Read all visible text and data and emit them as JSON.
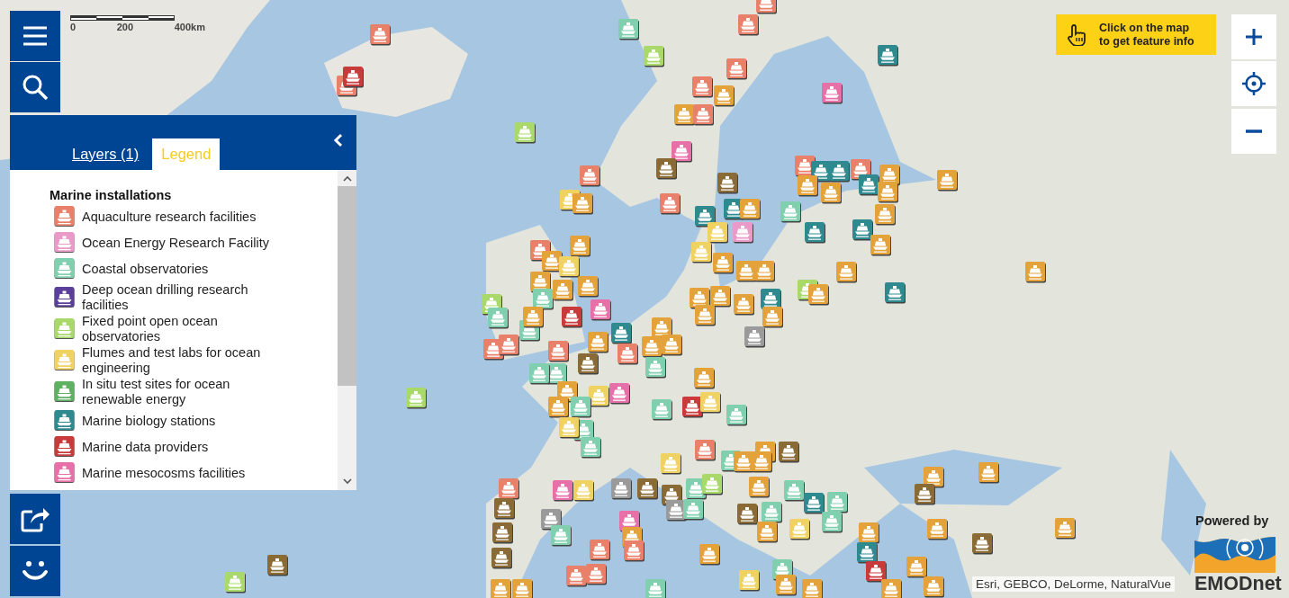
{
  "scale_bar": {
    "labels": [
      "0",
      "200",
      "400km"
    ]
  },
  "panel": {
    "tabs": [
      {
        "label": "Layers (1)",
        "selected": false
      },
      {
        "label": "Legend",
        "selected": true
      }
    ],
    "legend": {
      "title": "Marine installations",
      "items": [
        {
          "label": "Aquaculture research facilities",
          "color": "#e8806a"
        },
        {
          "label": "Ocean Energy Research Facility",
          "color": "#e99ac9"
        },
        {
          "label": "Coastal observatories",
          "color": "#80cfae"
        },
        {
          "label": "Deep ocean drilling research facilities",
          "color": "#5b3f9b"
        },
        {
          "label": "Fixed point open ocean observatories",
          "color": "#a9d86b"
        },
        {
          "label": "Flumes and test labs for ocean engineering",
          "color": "#f0d263"
        },
        {
          "label": "In situ test sites for ocean renewable energy",
          "color": "#5fb162"
        },
        {
          "label": "Marine biology stations",
          "color": "#2f8a90"
        },
        {
          "label": "Marine data providers",
          "color": "#c93a3a"
        },
        {
          "label": "Marine mesocosms facilities",
          "color": "#e870a9"
        }
      ]
    }
  },
  "info_tip": {
    "lines": [
      "Click on the map",
      "to get feature info"
    ]
  },
  "attribution": "Esri, GEBCO, DeLorme, NaturalVue",
  "branding": {
    "powered_by": "Powered by",
    "logo_text": "EMODnet"
  }
}
